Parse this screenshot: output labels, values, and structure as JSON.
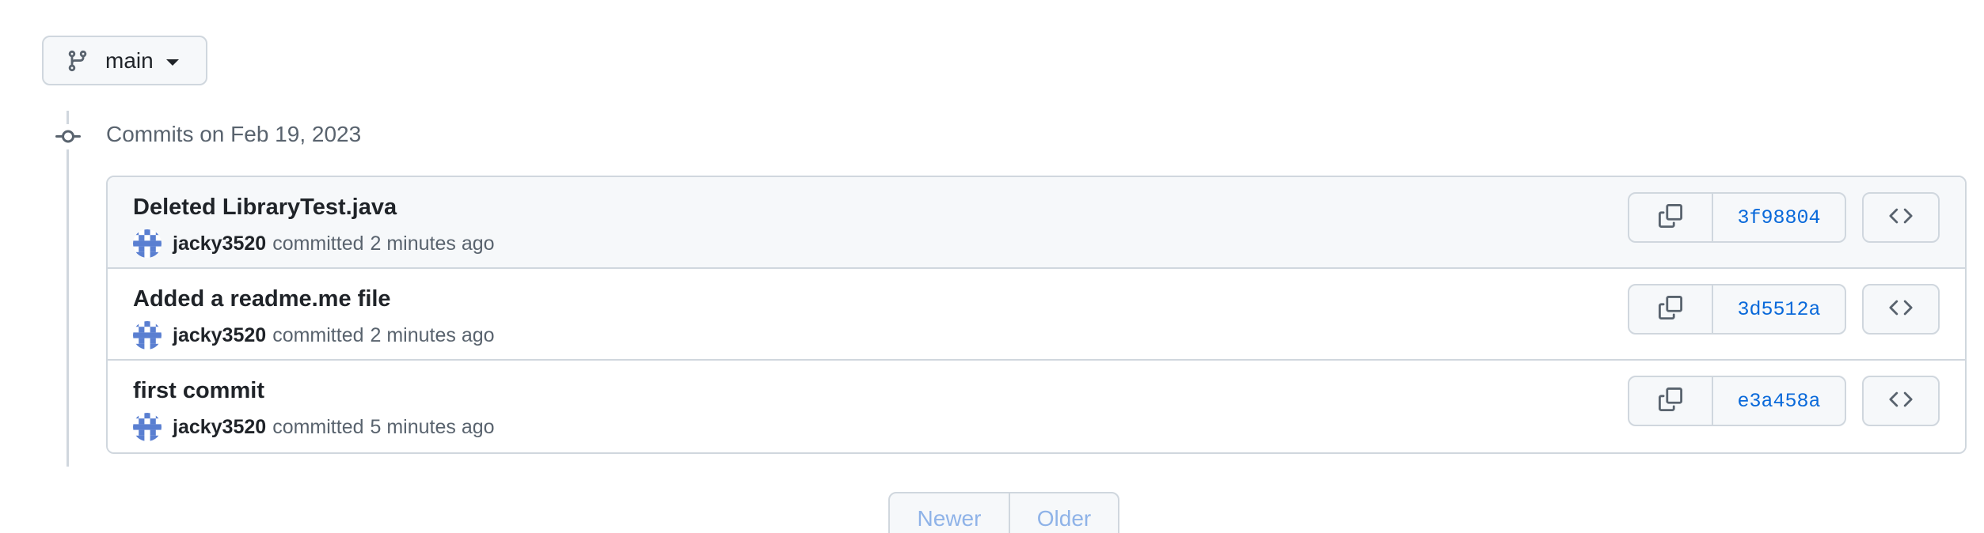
{
  "branch": {
    "name": "main",
    "icon": "git-branch-icon"
  },
  "timeline": {
    "heading": "Commits on Feb 19, 2023",
    "icon": "git-commit-icon"
  },
  "commits": [
    {
      "title": "Deleted LibraryTest.java",
      "author": "jacky3520",
      "action": "committed",
      "time": "2 minutes ago",
      "sha": "3f98804"
    },
    {
      "title": "Added a readme.me file",
      "author": "jacky3520",
      "action": "committed",
      "time": "2 minutes ago",
      "sha": "3d5512a"
    },
    {
      "title": "first commit",
      "author": "jacky3520",
      "action": "committed",
      "time": "5 minutes ago",
      "sha": "e3a458a"
    }
  ],
  "pagination": {
    "newer": "Newer",
    "older": "Older",
    "disabled_color": "#8fb3e8"
  },
  "colors": {
    "link": "#0969da",
    "border": "#d0d7de",
    "muted": "#59636e",
    "avatar": "#5a7fd1"
  }
}
